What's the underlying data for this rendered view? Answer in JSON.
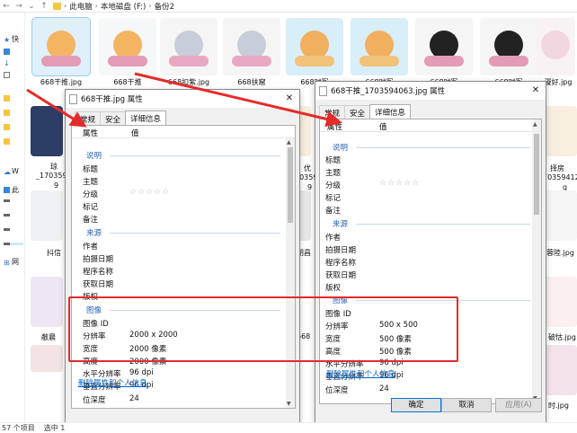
{
  "explorer": {
    "breadcrumb": [
      "此电脑",
      "本地磁盘 (F:)",
      "备份2"
    ],
    "sidebar_items": [
      "快",
      "W",
      "此",
      "网"
    ],
    "status": {
      "count": "57 个项目",
      "selected": "选中 1"
    },
    "thumbnails_row1": [
      "668干推.jpg",
      "668干推",
      "668扣紫.jpg",
      "668扶窟",
      "668时冤",
      "668时冤",
      "668时冤",
      "漫好.jpg"
    ],
    "side_labels": {
      "left1": "琼",
      "left2": "_170359",
      "left3": "9",
      "left4": "抖信",
      "left5": "敝晨",
      "mid1": "优",
      "mid2": "70359",
      "mid3": "9",
      "mid4": "朗昌",
      "mid5": "668",
      "right1": "择房",
      "right2": "70359412",
      "right3": "g",
      "right4": "蓉陸.jpg",
      "right5": "破怙.jpg",
      "right6": "时.jpg"
    }
  },
  "dialog_left": {
    "title": "668干推.jpg 属性",
    "tabs": [
      "常规",
      "安全",
      "详细信息"
    ],
    "active_tab": "详细信息",
    "header": {
      "property": "属性",
      "value": "值"
    },
    "sections": {
      "description": "说明",
      "origin": "来源",
      "image": "图像"
    },
    "description_rows": [
      "标题",
      "主题",
      "分级",
      "标记",
      "备注"
    ],
    "origin_rows": [
      "作者",
      "拍摄日期",
      "程序名称",
      "获取日期",
      "版权"
    ],
    "image_rows": [
      {
        "label": "图像 ID",
        "value": ""
      },
      {
        "label": "分辨率",
        "value": "2000 x 2000"
      },
      {
        "label": "宽度",
        "value": "2000 像素"
      },
      {
        "label": "高度",
        "value": "2000 像素"
      },
      {
        "label": "水平分辨率",
        "value": "96 dpi"
      },
      {
        "label": "垂直分辨率",
        "value": "96 dpi"
      },
      {
        "label": "位深度",
        "value": "24"
      }
    ],
    "rating": "☆☆☆☆☆",
    "remove_link": "删除属性和个人信息"
  },
  "dialog_right": {
    "title": "668干推_1703594063.jpg 属性",
    "tabs": [
      "常规",
      "安全",
      "详细信息"
    ],
    "active_tab": "详细信息",
    "header": {
      "property": "属性",
      "value": "值"
    },
    "sections": {
      "description": "说明",
      "origin": "来源",
      "image": "图像"
    },
    "description_rows": [
      "标题",
      "主题",
      "分级",
      "标记",
      "备注"
    ],
    "origin_rows": [
      "作者",
      "拍摄日期",
      "程序名称",
      "获取日期",
      "版权"
    ],
    "image_rows": [
      {
        "label": "图像 ID",
        "value": ""
      },
      {
        "label": "分辨率",
        "value": "500 x 500"
      },
      {
        "label": "宽度",
        "value": "500 像素"
      },
      {
        "label": "高度",
        "value": "500 像素"
      },
      {
        "label": "水平分辨率",
        "value": "96 dpi"
      },
      {
        "label": "垂直分辨率",
        "value": "96 dpi"
      },
      {
        "label": "位深度",
        "value": "24"
      }
    ],
    "rating": "☆☆☆☆☆",
    "remove_link": "删除属性和个人信息",
    "buttons": {
      "ok": "确定",
      "cancel": "取消",
      "apply": "应用(A)"
    }
  },
  "colors": {
    "annotation": "#e52a2a",
    "link": "#0066cc",
    "section": "#2a64b8",
    "selection": "#cce8ff"
  }
}
